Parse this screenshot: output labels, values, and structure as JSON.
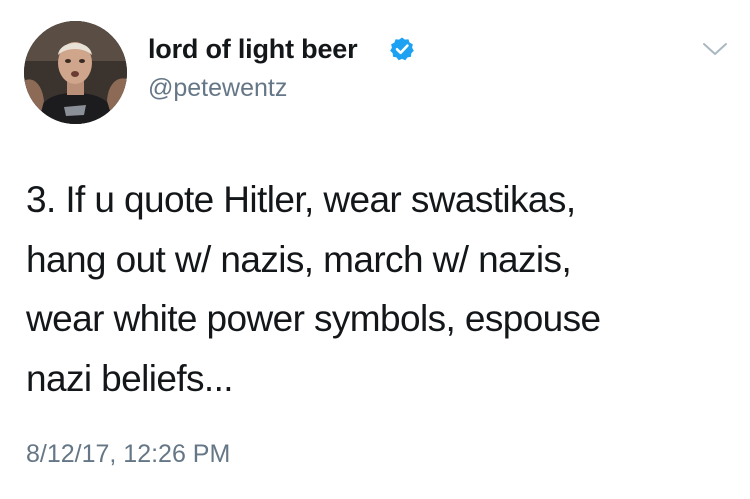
{
  "tweet": {
    "display_name": "lord of light beer",
    "handle": "@petewentz",
    "verified": true,
    "text": "3. If u quote Hitler, wear swastikas,\nhang out w/ nazis, march w/ nazis,\nwear  white power symbols, espouse\nnazi beliefs...",
    "timestamp": "8/12/17, 12:26 PM"
  },
  "icons": {
    "verified": "verified-badge-icon",
    "menu": "chevron-down-icon"
  },
  "colors": {
    "verified": "#1da1f2",
    "secondary_text": "#657786",
    "primary_text": "#14171a",
    "chevron": "#aab8c2"
  }
}
